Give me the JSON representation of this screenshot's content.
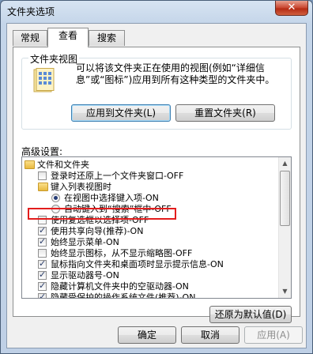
{
  "window": {
    "title": "文件夹选项",
    "close_glyph": "✕"
  },
  "tabs": [
    {
      "label": "常规",
      "active": false
    },
    {
      "label": "查看",
      "active": true
    },
    {
      "label": "搜索",
      "active": false
    }
  ],
  "folder_views": {
    "group_title": "文件夹视图",
    "icon": "folder-view-icon",
    "description": "可以将该文件夹正在使用的视图(例如“详细信息”或“图标”)应用到所有这种类型的文件夹中。",
    "apply_button": "应用到文件夹(L)",
    "reset_button": "重置文件夹(R)"
  },
  "advanced": {
    "label": "高级设置:",
    "items": [
      {
        "kind": "folder",
        "level": 0,
        "label": "文件和文件夹"
      },
      {
        "kind": "checkbox",
        "level": 1,
        "checked": false,
        "label": "登录时还原上一个文件夹窗口-OFF"
      },
      {
        "kind": "folder",
        "level": 1,
        "label": "键入列表视图时"
      },
      {
        "kind": "radio",
        "level": 2,
        "checked": true,
        "label": "在视图中选择键入项-ON"
      },
      {
        "kind": "radio",
        "level": 2,
        "checked": false,
        "label": "自动键入到“搜索”框中-OFF"
      },
      {
        "kind": "checkbox",
        "level": 1,
        "checked": false,
        "label": "使用复选框以选择项-OFF"
      },
      {
        "kind": "checkbox",
        "level": 1,
        "checked": true,
        "label": "使用共享向导(推荐)-ON"
      },
      {
        "kind": "checkbox",
        "level": 1,
        "checked": true,
        "label": "始终显示菜单-ON"
      },
      {
        "kind": "checkbox",
        "level": 1,
        "checked": false,
        "label": "始终显示图标，从不显示缩略图-OFF"
      },
      {
        "kind": "checkbox",
        "level": 1,
        "checked": true,
        "label": "鼠标指向文件夹和桌面项时显示提示信息-ON"
      },
      {
        "kind": "checkbox",
        "level": 1,
        "checked": true,
        "label": "显示驱动器号-ON"
      },
      {
        "kind": "checkbox",
        "level": 1,
        "checked": true,
        "label": "隐藏计算机文件夹中的空驱动器-ON"
      },
      {
        "kind": "checkbox",
        "level": 1,
        "checked": true,
        "label": "隐藏受保护的操作系统文件(推荐)-ON"
      }
    ],
    "restore_button": "还原为默认值(D)"
  },
  "footer": {
    "ok": "确定",
    "cancel": "取消",
    "apply": "应用(A)"
  },
  "colors": {
    "highlight": "#e31d1d",
    "title_bg": "#c4d5e9"
  }
}
